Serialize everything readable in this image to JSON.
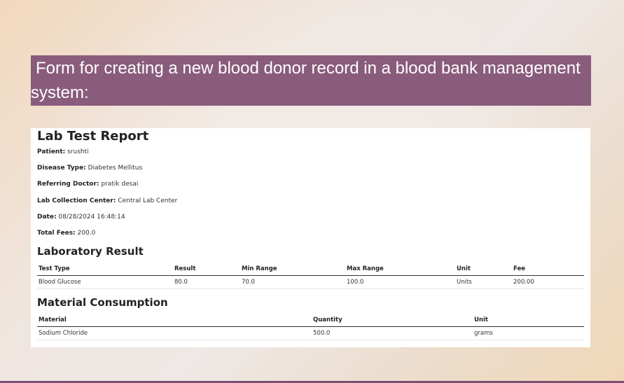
{
  "banner": {
    "text": "Form for creating a new blood donor record in a blood bank management system:"
  },
  "report": {
    "title": "Lab Test Report",
    "fields": [
      {
        "label": "Patient:",
        "value": " srushti"
      },
      {
        "label": "Disease Type:",
        "value": " Diabetes Mellitus"
      },
      {
        "label": "Referring Doctor:",
        "value": " pratik desai"
      },
      {
        "label": "Lab Collection Center:",
        "value": " Central Lab Center"
      },
      {
        "label": "Date:",
        "value": " 08/28/2024 16:48:14"
      },
      {
        "label": "Total Fees:",
        "value": " 200.0"
      }
    ],
    "lab_result": {
      "heading": "Laboratory Result",
      "columns": [
        "Test Type",
        "Result",
        "Min Range",
        "Max Range",
        "Unit",
        "Fee"
      ],
      "rows": [
        [
          "Blood Glucose",
          "80.0",
          "70.0",
          "100.0",
          "Units",
          "200.00"
        ]
      ]
    },
    "material": {
      "heading": "Material Consumption",
      "columns": [
        "Material",
        "Quantity",
        "Unit"
      ],
      "rows": [
        [
          "Sodium Chloride",
          "500.0",
          "grams"
        ]
      ]
    }
  },
  "colors": {
    "banner": "#8a5c7b",
    "bottom_bar": "#7a5070"
  }
}
